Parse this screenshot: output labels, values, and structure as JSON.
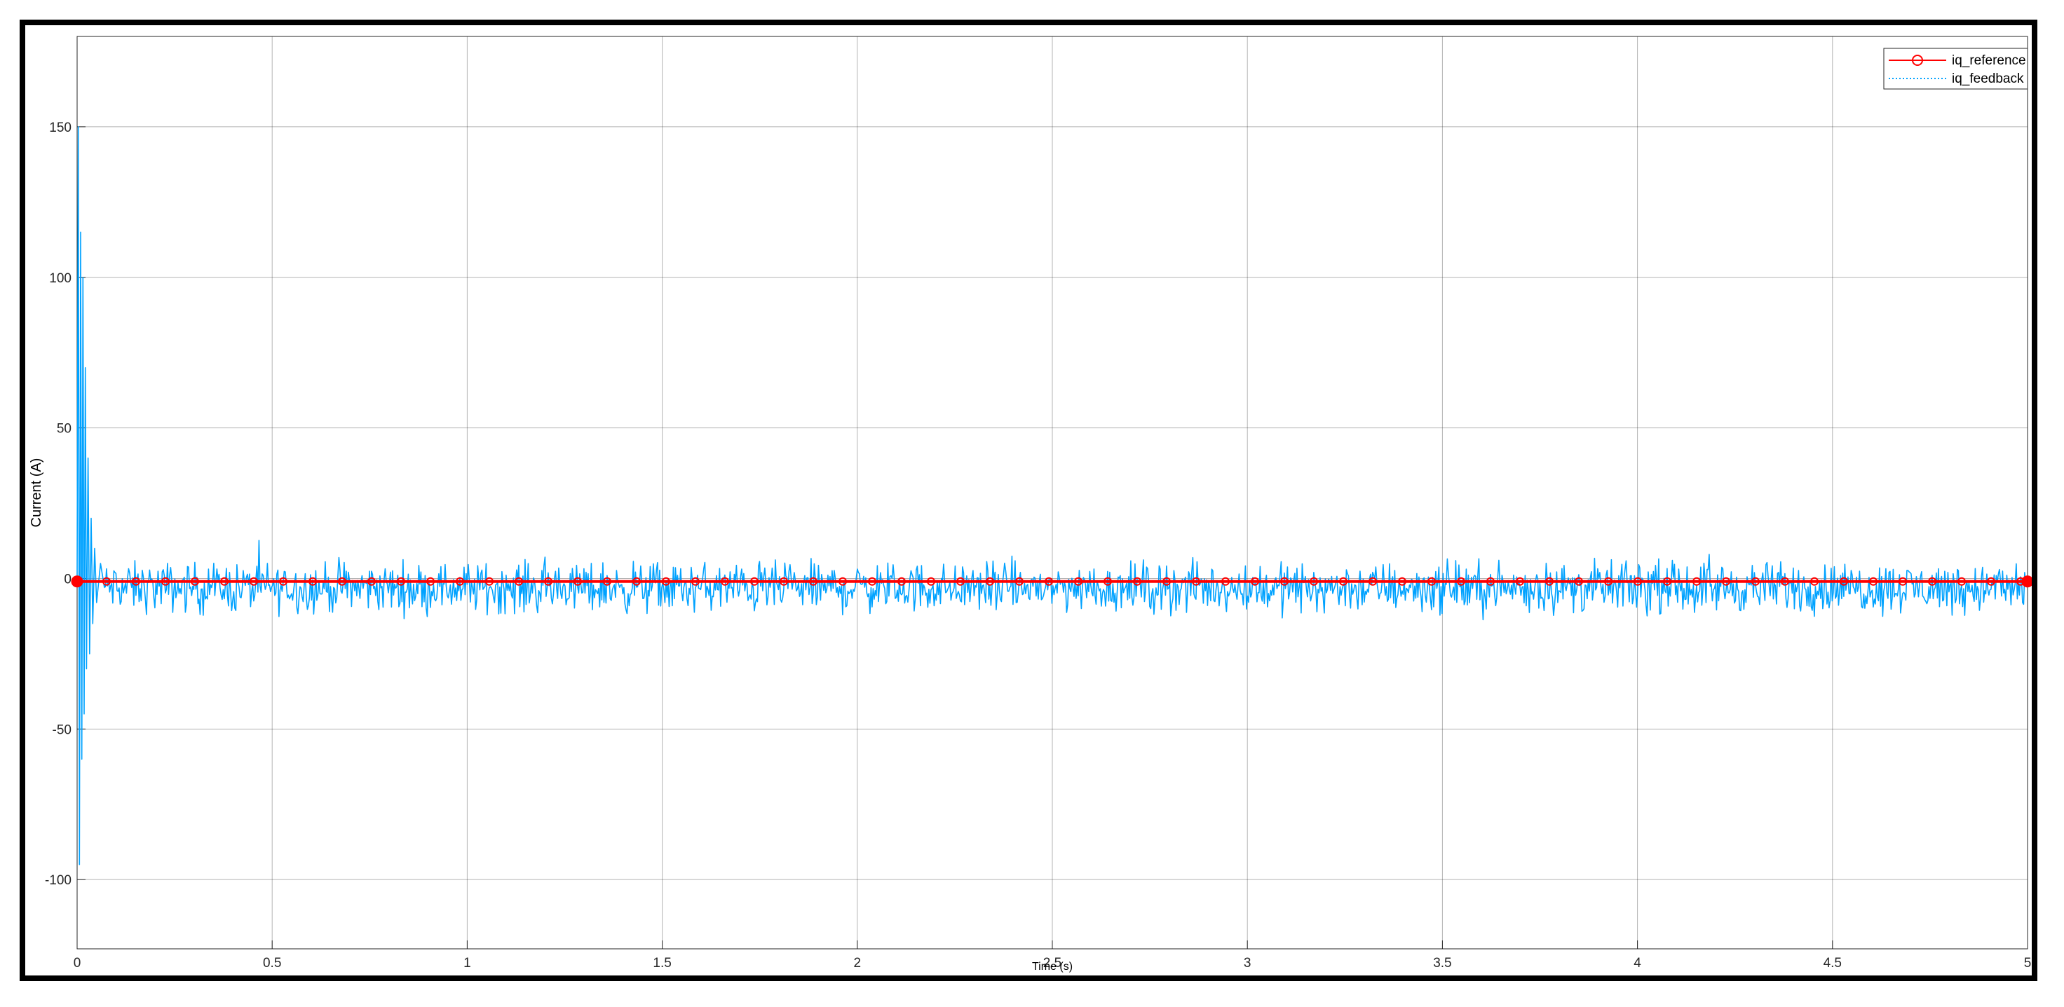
{
  "chart_data": {
    "type": "line",
    "xlabel": "Time (s)",
    "ylabel": "Current (A)",
    "xlim": [
      0,
      5
    ],
    "ylim": [
      -123,
      180
    ],
    "x_ticks": [
      0,
      0.5,
      1,
      1.5,
      2,
      2.5,
      3,
      3.5,
      4,
      4.5,
      5
    ],
    "x_tick_labels": [
      "0",
      "0.5",
      "1",
      "1.5",
      "2",
      "2.5",
      "3",
      "3.5",
      "4",
      "4.5",
      "5"
    ],
    "y_ticks": [
      -100,
      -50,
      0,
      50,
      100,
      150
    ],
    "y_tick_labels": [
      "-100",
      "-50",
      "0",
      "50",
      "100",
      "150"
    ],
    "grid": true,
    "legend_position": "top-right",
    "series": [
      {
        "name": "iq_reference",
        "color": "#ff0000",
        "style": "solid-circle-markers",
        "x": [
          0,
          5
        ],
        "y": [
          -1,
          -1
        ]
      },
      {
        "name": "iq_feedback",
        "color": "#00a2ff",
        "style": "dotted",
        "x": [
          0,
          0.003,
          0.006,
          0.009,
          0.012,
          0.015,
          0.018,
          0.021,
          0.024,
          0.028,
          0.032,
          0.036,
          0.04,
          0.045,
          0.05,
          0.06,
          0.07
        ],
        "y": [
          0,
          150,
          -95,
          115,
          -60,
          100,
          -45,
          70,
          -30,
          40,
          -25,
          20,
          -15,
          10,
          -8,
          5,
          -3
        ],
        "noise_mean": -3,
        "noise_amplitude": 12
      }
    ]
  }
}
